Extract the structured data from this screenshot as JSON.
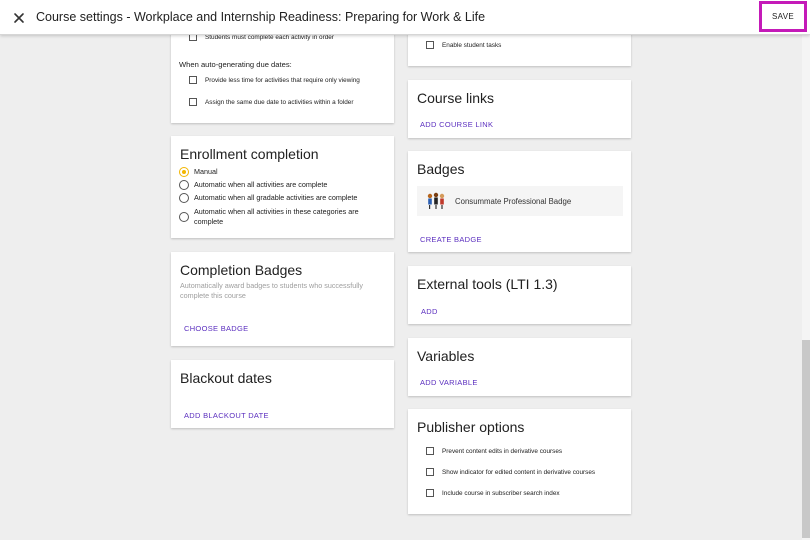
{
  "header": {
    "title": "Course settings - Workplace and Internship Readiness: Preparing for Work & Life",
    "save_label": "SAVE"
  },
  "left": {
    "activity": {
      "must_complete_label": "Students must complete each activity in order",
      "autogen_heading": "When auto-generating due dates:",
      "less_time_label": "Provide less time for activities that require only viewing",
      "same_due_date_label": "Assign the same due date to activities within a folder"
    },
    "enrollment": {
      "title": "Enrollment completion",
      "options": [
        "Manual",
        "Automatic when all activities are complete",
        "Automatic when all gradable activities are complete",
        "Automatic when all activities in these categories are complete"
      ],
      "selected": 0
    },
    "completion_badges": {
      "title": "Completion Badges",
      "description": "Automatically award badges to students who successfully complete this course",
      "choose_label": "CHOOSE BADGE"
    },
    "blackout": {
      "title": "Blackout dates",
      "add_label": "ADD BLACKOUT DATE"
    }
  },
  "right": {
    "tasks": {
      "enable_label": "Enable student tasks"
    },
    "course_links": {
      "title": "Course links",
      "add_label": "ADD COURSE LINK"
    },
    "badges": {
      "title": "Badges",
      "badge_name": "Consummate Professional Badge",
      "create_label": "CREATE BADGE"
    },
    "external_tools": {
      "title": "External tools (LTI 1.3)",
      "add_label": "ADD"
    },
    "variables": {
      "title": "Variables",
      "add_label": "ADD VARIABLE"
    },
    "publisher": {
      "title": "Publisher options",
      "prevent_label": "Prevent content edits in derivative courses",
      "indicator_label": "Show indicator for edited content in derivative courses",
      "include_label": "Include course in subscriber search index"
    }
  },
  "colors": {
    "accent_link": "#5b2fbf",
    "radio_selected": "#f2b600",
    "save_highlight": "#c41ab8"
  },
  "icons": {
    "close": "close-icon",
    "badge": "badge-people-icon"
  }
}
